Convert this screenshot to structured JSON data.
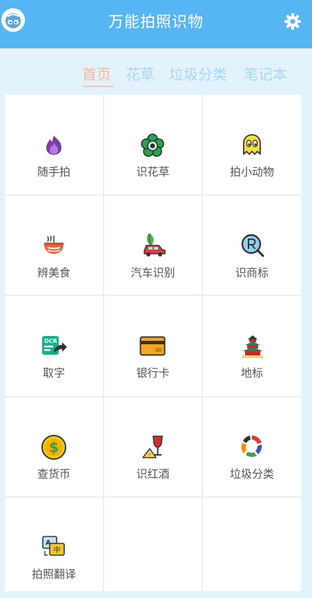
{
  "header": {
    "title": "万能拍照识物",
    "avatar_icon": "avatar-icon",
    "settings_icon": "gear-icon"
  },
  "tabs": [
    {
      "label": "首页",
      "active": true
    },
    {
      "label": "花草",
      "active": false
    },
    {
      "label": "垃圾分类",
      "active": false
    },
    {
      "label": "笔记本",
      "active": false
    }
  ],
  "features": [
    {
      "label": "随手拍",
      "icon": "flame-icon"
    },
    {
      "label": "识花草",
      "icon": "flower-icon"
    },
    {
      "label": "拍小动物",
      "icon": "ghost-icon"
    },
    {
      "label": "辨美食",
      "icon": "bowl-icon"
    },
    {
      "label": "汽车识别",
      "icon": "car-icon"
    },
    {
      "label": "识商标",
      "icon": "trademark-icon"
    },
    {
      "label": "取字",
      "icon": "ocr-icon"
    },
    {
      "label": "银行卡",
      "icon": "bank-card-icon"
    },
    {
      "label": "地标",
      "icon": "landmark-icon"
    },
    {
      "label": "查货币",
      "icon": "coin-icon"
    },
    {
      "label": "识红酒",
      "icon": "wine-icon"
    },
    {
      "label": "垃圾分类",
      "icon": "recycle-icon"
    },
    {
      "label": "拍照翻译",
      "icon": "translate-icon"
    }
  ],
  "colors": {
    "header_bg": "#56b6f4",
    "tab_active": "#f7b79a",
    "tab_inactive": "#a7d8f2"
  }
}
